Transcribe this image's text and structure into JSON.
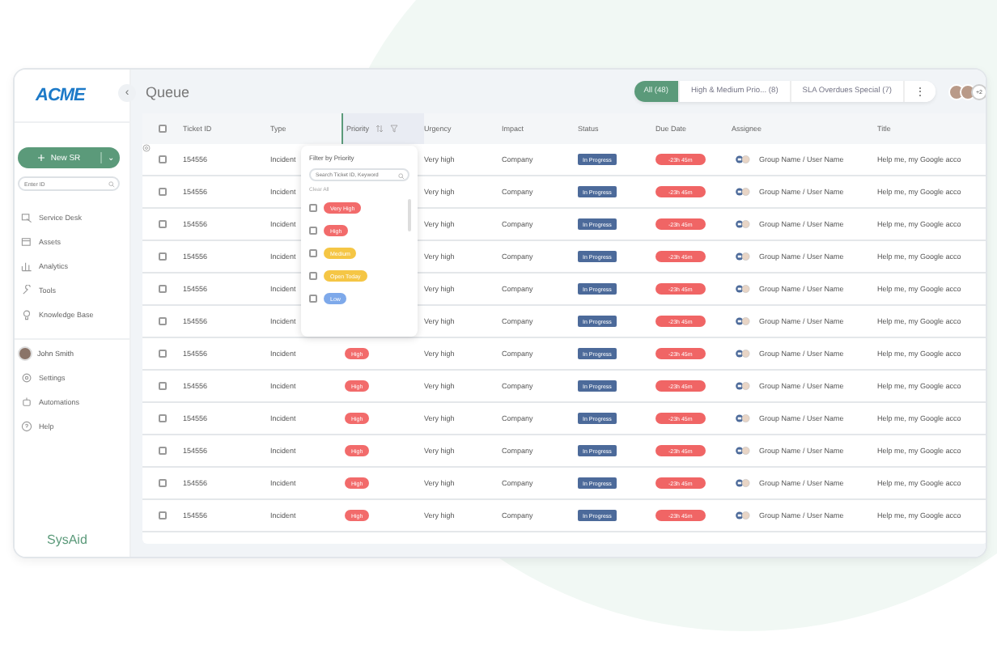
{
  "logo": "ACME",
  "collapse_button": "‹",
  "sidebar": {
    "new_button": "New SR",
    "new_button_caret": "⌄",
    "search": {
      "placeholder": "Enter ID"
    },
    "nav": [
      {
        "label": "Service Desk"
      },
      {
        "label": "Assets"
      },
      {
        "label": "Analytics"
      },
      {
        "label": "Tools"
      },
      {
        "label": "Knowledge Base"
      }
    ],
    "user": {
      "name": "John Smith"
    },
    "bottom_nav": [
      {
        "label": "Settings"
      },
      {
        "label": "Automations"
      },
      {
        "label": "Help"
      }
    ],
    "footer_logo": "SysAid"
  },
  "page_title": "Queue",
  "tabs": [
    {
      "label": "All (48)",
      "selected": true
    },
    {
      "label": "High & Medium Prio... (8)",
      "selected": false
    },
    {
      "label": "SLA Overdues Special (7)",
      "selected": false
    }
  ],
  "more_button": "⋮",
  "viewers": {
    "more_count": "+2"
  },
  "table": {
    "columns": [
      "Ticket ID",
      "Type",
      "Priority",
      "Urgency",
      "Impact",
      "Status",
      "Due Date",
      "Assignee",
      "Title"
    ],
    "header_checked": false,
    "filter_menu": {
      "title": "Filter by Priority",
      "search": {
        "placeholder": "Search Ticket ID, Keyword"
      },
      "clear": "Clear All",
      "options": [
        {
          "label": "Very High",
          "checked": false,
          "color": "#f26b6b"
        },
        {
          "label": "High",
          "checked": false,
          "color": "#f26b6b"
        },
        {
          "label": "Medium",
          "checked": false,
          "color": "#f5c645"
        },
        {
          "label": "Open Today",
          "checked": false,
          "color": "#f5c645"
        },
        {
          "label": "Low",
          "checked": false,
          "color": "#7ea9ea"
        }
      ]
    },
    "rows": [
      {
        "checked": false,
        "ticket_id": "154556",
        "type": "Incident",
        "urgency": "Very high",
        "impact": "Company",
        "status": "In Progress",
        "due": "-23h 45m",
        "assignee": "Group Name / User Name",
        "title": "Help me, my Google acco"
      },
      {
        "checked": false,
        "ticket_id": "154556",
        "type": "Incident",
        "urgency": "Very high",
        "impact": "Company",
        "status": "In Progress",
        "due": "-23h 45m",
        "assignee": "Group Name / User Name",
        "title": "Help me, my Google acco"
      },
      {
        "checked": false,
        "ticket_id": "154556",
        "type": "Incident",
        "urgency": "Very high",
        "impact": "Company",
        "status": "In Progress",
        "due": "-23h 45m",
        "assignee": "Group Name / User Name",
        "title": "Help me, my Google acco"
      },
      {
        "checked": false,
        "ticket_id": "154556",
        "type": "Incident",
        "urgency": "Very high",
        "impact": "Company",
        "status": "In Progress",
        "due": "-23h 45m",
        "assignee": "Group Name / User Name",
        "title": "Help me, my Google acco"
      },
      {
        "checked": false,
        "ticket_id": "154556",
        "type": "Incident",
        "urgency": "Very high",
        "impact": "Company",
        "status": "In Progress",
        "due": "-23h 45m",
        "assignee": "Group Name / User Name",
        "title": "Help me, my Google acco"
      },
      {
        "checked": false,
        "ticket_id": "154556",
        "type": "Incident",
        "urgency": "Very high",
        "impact": "Company",
        "status": "In Progress",
        "due": "-23h 45m",
        "assignee": "Group Name / User Name",
        "title": "Help me, my Google acco"
      },
      {
        "checked": false,
        "ticket_id": "154556",
        "type": "Incident",
        "priority": "High",
        "urgency": "Very high",
        "impact": "Company",
        "status": "In Progress",
        "due": "-23h 45m",
        "assignee": "Group Name / User Name",
        "title": "Help me, my Google acco"
      },
      {
        "checked": false,
        "ticket_id": "154556",
        "type": "Incident",
        "priority": "High",
        "urgency": "Very high",
        "impact": "Company",
        "status": "In Progress",
        "due": "-23h 45m",
        "assignee": "Group Name / User Name",
        "title": "Help me, my Google acco"
      },
      {
        "checked": false,
        "ticket_id": "154556",
        "type": "Incident",
        "priority": "High",
        "urgency": "Very high",
        "impact": "Company",
        "status": "In Progress",
        "due": "-23h 45m",
        "assignee": "Group Name / User Name",
        "title": "Help me, my Google acco"
      },
      {
        "checked": false,
        "ticket_id": "154556",
        "type": "Incident",
        "priority": "High",
        "urgency": "Very high",
        "impact": "Company",
        "status": "In Progress",
        "due": "-23h 45m",
        "assignee": "Group Name / User Name",
        "title": "Help me, my Google acco"
      },
      {
        "checked": false,
        "ticket_id": "154556",
        "type": "Incident",
        "priority": "High",
        "urgency": "Very high",
        "impact": "Company",
        "status": "In Progress",
        "due": "-23h 45m",
        "assignee": "Group Name / User Name",
        "title": "Help me, my Google acco"
      },
      {
        "checked": false,
        "ticket_id": "154556",
        "type": "Incident",
        "priority": "High",
        "urgency": "Very high",
        "impact": "Company",
        "status": "In Progress",
        "due": "-23h 45m",
        "assignee": "Group Name / User Name",
        "title": "Help me, my Google acco"
      }
    ]
  }
}
